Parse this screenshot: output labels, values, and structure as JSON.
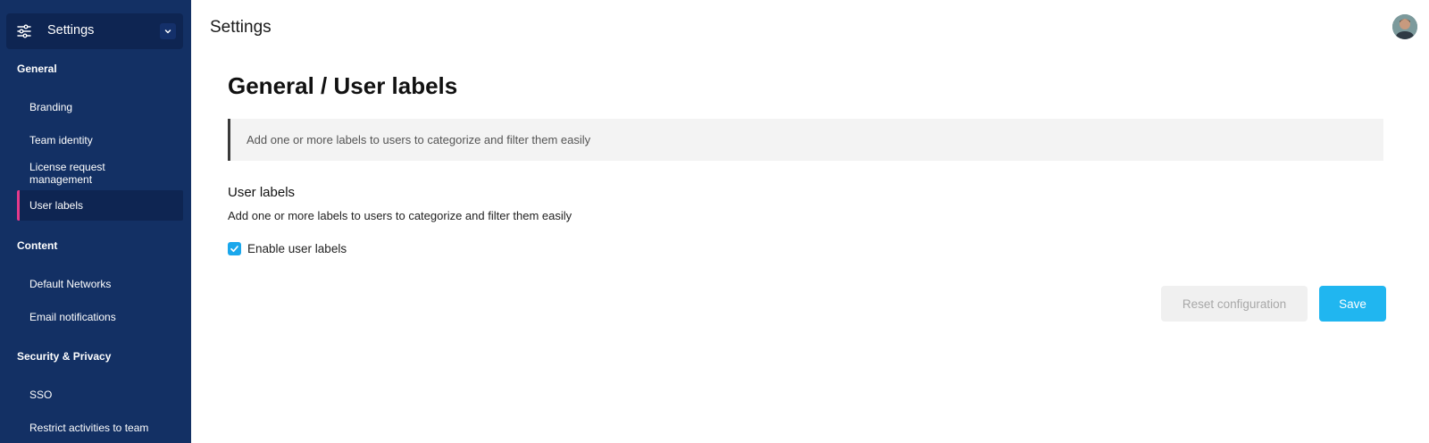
{
  "sidebar": {
    "app_title": "Settings",
    "app_icon": "sliders-icon",
    "sections": [
      {
        "title": "General",
        "items": [
          "Branding",
          "Team identity",
          "License request management",
          "User labels"
        ]
      },
      {
        "title": "Content",
        "items": [
          "Default Networks",
          "Email notifications"
        ]
      },
      {
        "title": "Security & Privacy",
        "items": [
          "SSO",
          "Restrict activities to team"
        ]
      }
    ],
    "active_item": "User labels",
    "accent_color": "#e5398b",
    "background_color": "#133064"
  },
  "header": {
    "title": "Settings",
    "avatar_icon": "user-avatar"
  },
  "main": {
    "page_title": "General / User labels",
    "info_text": "Add one or more labels to users to categorize and filter them easily",
    "section_heading": "User labels",
    "section_description": "Add one or more labels to users to categorize and filter them easily",
    "checkbox_label": "Enable user labels",
    "checkbox_checked": true,
    "reset_button_label": "Reset configuration",
    "save_button_label": "Save",
    "save_color": "#20b6f0"
  }
}
